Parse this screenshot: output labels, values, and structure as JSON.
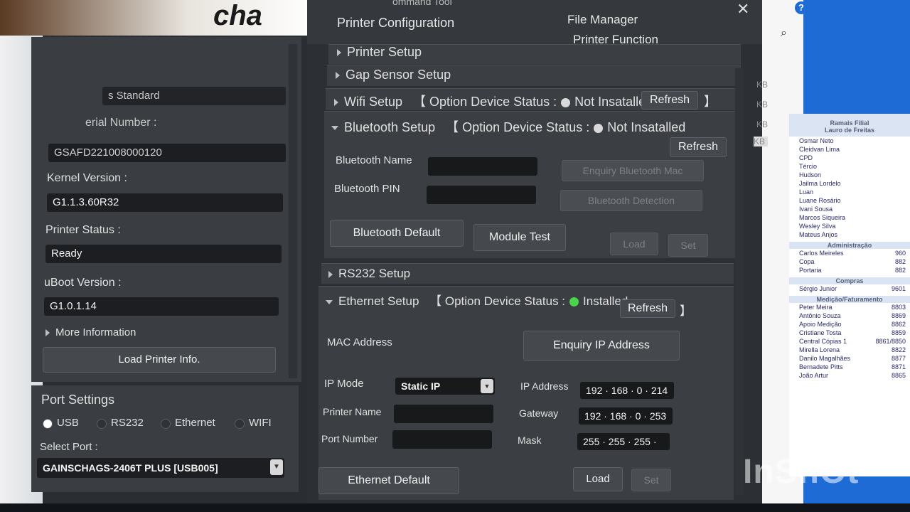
{
  "app": {
    "logo": "cha",
    "title_partial": "ommand Tool"
  },
  "left": {
    "field1_label": "s Standard",
    "serial_label": "erial Number :",
    "serial_value": "GSAFD221008000120",
    "kernel_label": "Kernel Version :",
    "kernel_value": "G1.1.3.60R32",
    "status_label": "Printer Status :",
    "status_value": "Ready",
    "uboot_label": "uBoot Version :",
    "uboot_value": "G1.0.1.14",
    "more_info": "More Information",
    "load_button": "Load Printer Info."
  },
  "port": {
    "title": "Port Settings",
    "options": [
      "USB",
      "RS232",
      "Ethernet",
      "WIFI"
    ],
    "selected": "USB",
    "select_label": "Select Port :",
    "select_value": "GAINSCHAGS-2406T PLUS [USB005]"
  },
  "tabs": {
    "printer_config": "Printer Configuration",
    "file_manager": "File Manager",
    "printer_function": "Printer Function"
  },
  "sections": {
    "printer_setup": "Printer Setup",
    "gap_sensor": "Gap Sensor Setup",
    "wifi": "Wifi Setup",
    "bluetooth": "Bluetooth Setup",
    "rs232": "RS232 Setup",
    "ethernet": "Ethernet Setup"
  },
  "status": {
    "bracket_open": "【 Option Device Status :",
    "bracket_close": "】",
    "not_installed": "Not Insatalled",
    "installed": "Installed",
    "refresh": "Refresh"
  },
  "bluetooth": {
    "name_label": "Bluetooth Name",
    "pin_label": "Bluetooth PIN",
    "enquiry_mac": "Enquiry Bluetooth Mac",
    "detection": "Bluetooth Detection",
    "default_button": "Bluetooth Default",
    "module_test": "Module Test",
    "load": "Load",
    "set": "Set"
  },
  "ethernet": {
    "mac_label": "MAC Address",
    "enquiry_ip": "Enquiry IP Address",
    "ip_mode_label": "IP Mode",
    "ip_mode_value": "Static IP",
    "printer_name_label": "Printer Name",
    "port_number_label": "Port Number",
    "ip_address_label": "IP Address",
    "ip_address_value": "192 · 168 ·  0  · 214",
    "gateway_label": "Gateway",
    "gateway_value": "192 · 168 ·  0  · 253",
    "mask_label": "Mask",
    "mask_value": "255 · 255 · 255 ·",
    "default_button": "Ethernet Default",
    "load": "Load",
    "set": "Set"
  },
  "background": {
    "kb_labels": [
      "KB",
      "KB",
      "KB",
      "KB"
    ],
    "sheet_title1": "Ramais Filial",
    "sheet_title2": "Lauro de Freitas",
    "names": [
      "Osmar Neto",
      "Cleidvan Lima",
      "CPD",
      "Tércio",
      "Hudson",
      "Jailma Lordelo",
      "Luan",
      "Luane Rosário",
      "Ivani Sousa",
      "Marcos Siqueira",
      "Wesley Silva",
      "Mateus Anjos"
    ],
    "adm_header": "Administração",
    "adm_rows": [
      [
        "Carlos Meireles",
        "960"
      ],
      [
        "Copa",
        "882"
      ],
      [
        "Portaria",
        "882"
      ]
    ],
    "compras_header": "Compras",
    "compras_rows": [
      [
        "Sérgio Junior",
        "9601"
      ]
    ],
    "med_header": "Medição/Faturamento",
    "med_rows": [
      [
        "Peter Meira",
        "8803"
      ],
      [
        "Antônio Souza",
        "8869"
      ],
      [
        "Apoio Medição",
        "8862"
      ],
      [
        "Cristiane Tosta",
        "8859"
      ],
      [
        "Central Cópias 1",
        "8861/8850"
      ],
      [
        "Mirella Lorena",
        "8822"
      ],
      [
        "Danilo Magalhães",
        "8877"
      ],
      [
        "Bernadete Pitts",
        "8871"
      ],
      [
        "João Artur",
        "8865"
      ]
    ],
    "watermark": "InShOt"
  }
}
